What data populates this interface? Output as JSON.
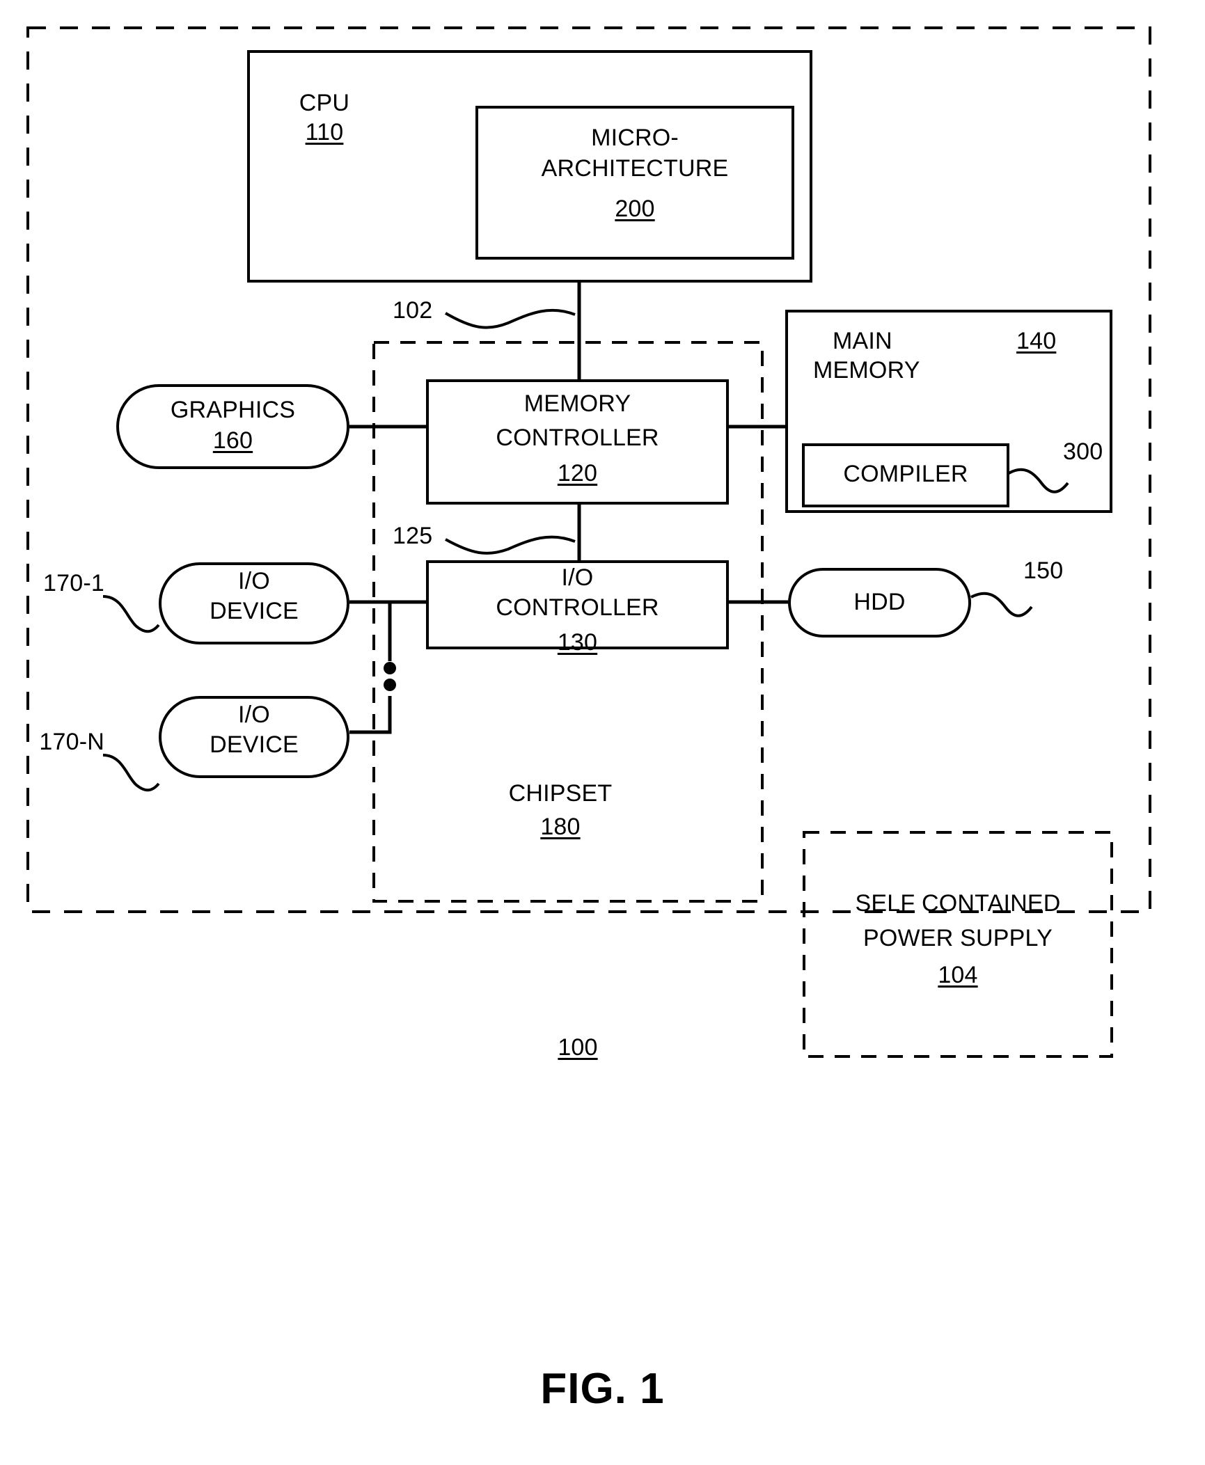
{
  "figure": {
    "caption": "FIG. 1",
    "system_ref": "100"
  },
  "blocks": {
    "cpu": {
      "label": "CPU",
      "ref": "110"
    },
    "microarchitecture": {
      "label_line1": "MICRO-",
      "label_line2": "ARCHITECTURE",
      "ref": "200"
    },
    "memory_controller": {
      "label_line1": "MEMORY",
      "label_line2": "CONTROLLER",
      "ref": "120"
    },
    "io_controller": {
      "label_line1": "I/O",
      "label_line2": "CONTROLLER",
      "ref": "130"
    },
    "main_memory": {
      "label_line1": "MAIN",
      "label_line2": "MEMORY",
      "ref": "140"
    },
    "compiler": {
      "label": "COMPILER",
      "ref": "300"
    },
    "graphics": {
      "label": "GRAPHICS",
      "ref": "160"
    },
    "hdd": {
      "label": "HDD",
      "ref": "150"
    },
    "io_device_1": {
      "label_line1": "I/O",
      "label_line2": "DEVICE",
      "ref": "170-1"
    },
    "io_device_n": {
      "label_line1": "I/O",
      "label_line2": "DEVICE",
      "ref": "170-N"
    },
    "chipset": {
      "label": "CHIPSET",
      "ref": "180"
    },
    "power_supply": {
      "label_line1": "SELF CONTAINED",
      "label_line2": "POWER SUPPLY",
      "ref": "104"
    }
  },
  "connectors": {
    "cpu_to_memory_controller_ref": "102",
    "memory_to_io_controller_ref": "125"
  },
  "icons": {
    "vertical_ellipsis": "vertical-ellipsis-icon",
    "leader_squiggle": "leader-squiggle-icon"
  },
  "colors": {
    "stroke": "#000000",
    "background": "#ffffff"
  }
}
